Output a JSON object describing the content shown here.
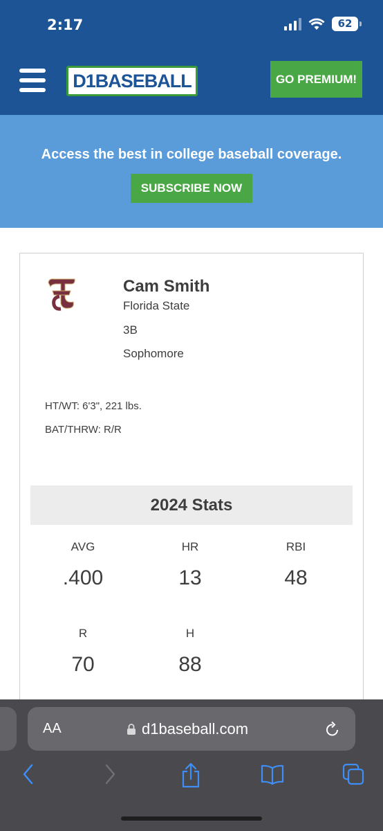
{
  "status_bar": {
    "time": "2:17",
    "battery": "62"
  },
  "header": {
    "logo_text": "D1BASEBALL",
    "premium_label": "GO PREMIUM!"
  },
  "promo": {
    "text": "Access the best in college baseball coverage.",
    "subscribe_label": "SUBSCRIBE NOW"
  },
  "player": {
    "name": "Cam Smith",
    "team": "Florida State",
    "position": "3B",
    "class_year": "Sophomore",
    "ht_wt": "HT/WT: 6'3\", 221 lbs.",
    "bat_throw": "BAT/THRW: R/R"
  },
  "stats": {
    "title": "2024 Stats",
    "items": [
      {
        "label": "AVG",
        "value": ".400"
      },
      {
        "label": "HR",
        "value": "13"
      },
      {
        "label": "RBI",
        "value": "48"
      },
      {
        "label": "R",
        "value": "70"
      },
      {
        "label": "H",
        "value": "88"
      }
    ]
  },
  "browser": {
    "aa_label": "AA",
    "url": "d1baseball.com"
  },
  "colors": {
    "header_blue": "#1d5495",
    "promo_blue": "#5a9bd9",
    "accent_green": "#4aa745",
    "fsu_garnet": "#782f40",
    "safari_blue": "#3e8ef7"
  },
  "icons": [
    "signal-icon",
    "wifi-icon",
    "battery-icon",
    "hamburger-menu-icon",
    "fsu-logo-icon",
    "lock-icon",
    "reload-icon",
    "back-icon",
    "forward-icon",
    "share-icon",
    "bookmarks-icon",
    "tabs-icon"
  ]
}
